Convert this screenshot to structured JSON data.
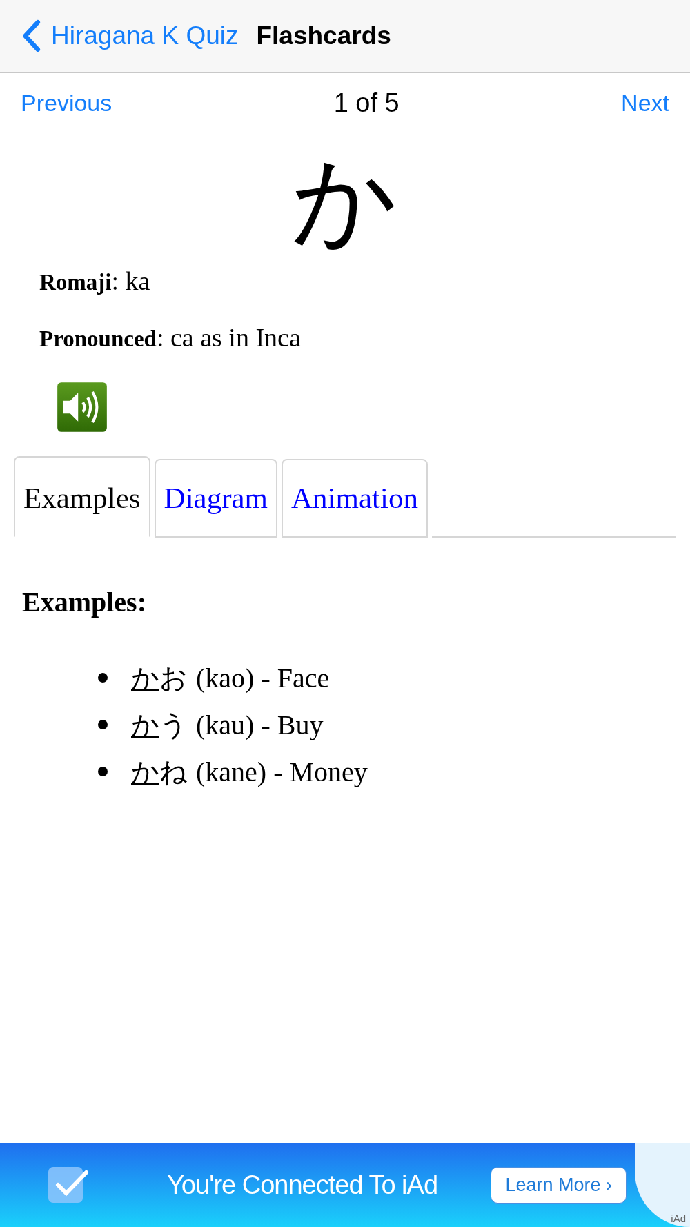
{
  "nav_bar": {
    "back_label": "Hiragana K Quiz",
    "title": "Flashcards"
  },
  "pager": {
    "previous": "Previous",
    "position": "1 of 5",
    "next": "Next"
  },
  "card": {
    "character": "か",
    "details": [
      {
        "label": "Romaji",
        "value": ": ka"
      },
      {
        "label": "Pronounced",
        "value": ": ca as in Inca"
      }
    ]
  },
  "tabs": [
    {
      "label": "Examples",
      "selected": true
    },
    {
      "label": "Diagram",
      "selected": false
    },
    {
      "label": "Animation",
      "selected": false
    }
  ],
  "examples": {
    "heading": "Examples:",
    "items": [
      {
        "underlined": "か",
        "rest": "お",
        "text": "(kao) - Face"
      },
      {
        "underlined": "か",
        "rest": "う",
        "text": "(kau) - Buy"
      },
      {
        "underlined": "か",
        "rest": "ね",
        "text": "(kane) - Money"
      }
    ]
  },
  "ad_banner": {
    "message": "You're Connected To iAd",
    "button": "Learn More ›",
    "corner_label": "iAd"
  }
}
